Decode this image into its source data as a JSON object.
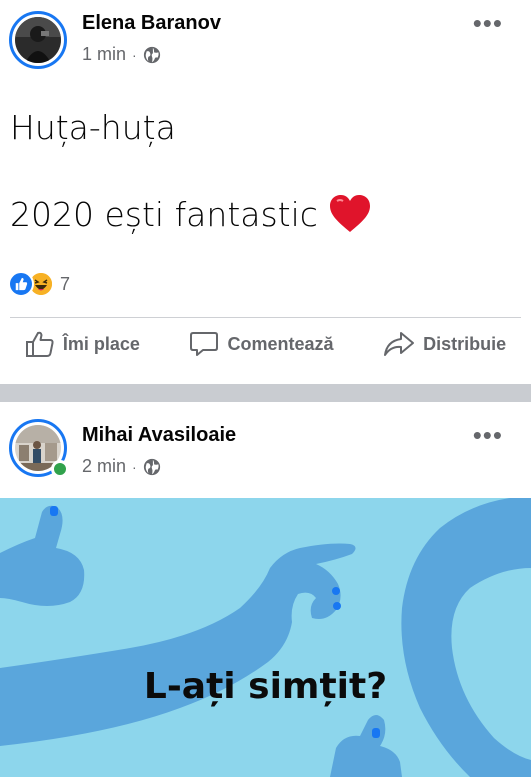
{
  "post1": {
    "author": "Elena Baranov",
    "time": "1 min",
    "separator": "·",
    "privacy_icon": "globe-icon",
    "more_icon": "more-horizontal-icon",
    "text_line1": "Huța-huța",
    "text_line2": "2020 ești fantastic",
    "heart_emoji": "❤️",
    "reaction_icons": [
      "like-reaction-icon",
      "haha-reaction-icon"
    ],
    "reaction_count": "7",
    "actions": {
      "like": "Îmi place",
      "comment": "Comentează",
      "share": "Distribuie"
    }
  },
  "post2": {
    "author": "Mihai Avasiloaie",
    "time": "2 min",
    "separator": "·",
    "privacy_icon": "globe-icon",
    "more_icon": "more-horizontal-icon",
    "online_status": "online",
    "image_caption": "L-ați simțit?"
  },
  "colors": {
    "accent": "#1877f2",
    "secondary_text": "#65676b",
    "separator": "#c9ccd1",
    "online": "#31a24c",
    "hero_background": "#8dd6ec",
    "hero_hands": "#5aa6dc"
  }
}
